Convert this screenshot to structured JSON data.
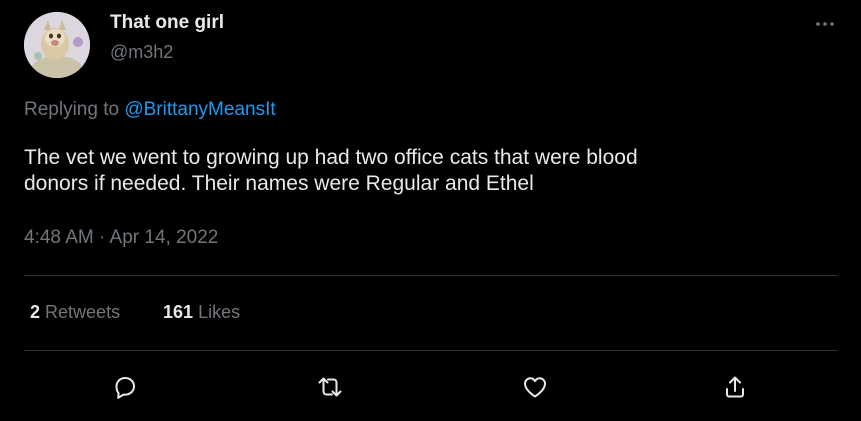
{
  "tweet": {
    "author": {
      "display_name": "That one girl",
      "handle": "@m3h2"
    },
    "replying_prefix": "Replying to",
    "replying_to": "@BrittanyMeansIt",
    "text_line1": "The vet we went to growing up had two office cats that were blood",
    "text_line2": "donors if needed. Their names were Regular and Ethel",
    "timestamp": "4:48 AM · Apr 14, 2022",
    "stats": {
      "retweets_count": "2",
      "retweets_label": "Retweets",
      "likes_count": "161",
      "likes_label": "Likes"
    },
    "actions": [
      "reply-icon",
      "retweet-icon",
      "like-icon",
      "share-icon"
    ]
  },
  "colors": {
    "background": "#000000",
    "primary_text": "#e7e9ea",
    "secondary_text": "#71767b",
    "link": "#1d9bf0",
    "divider": "#2f3336"
  }
}
